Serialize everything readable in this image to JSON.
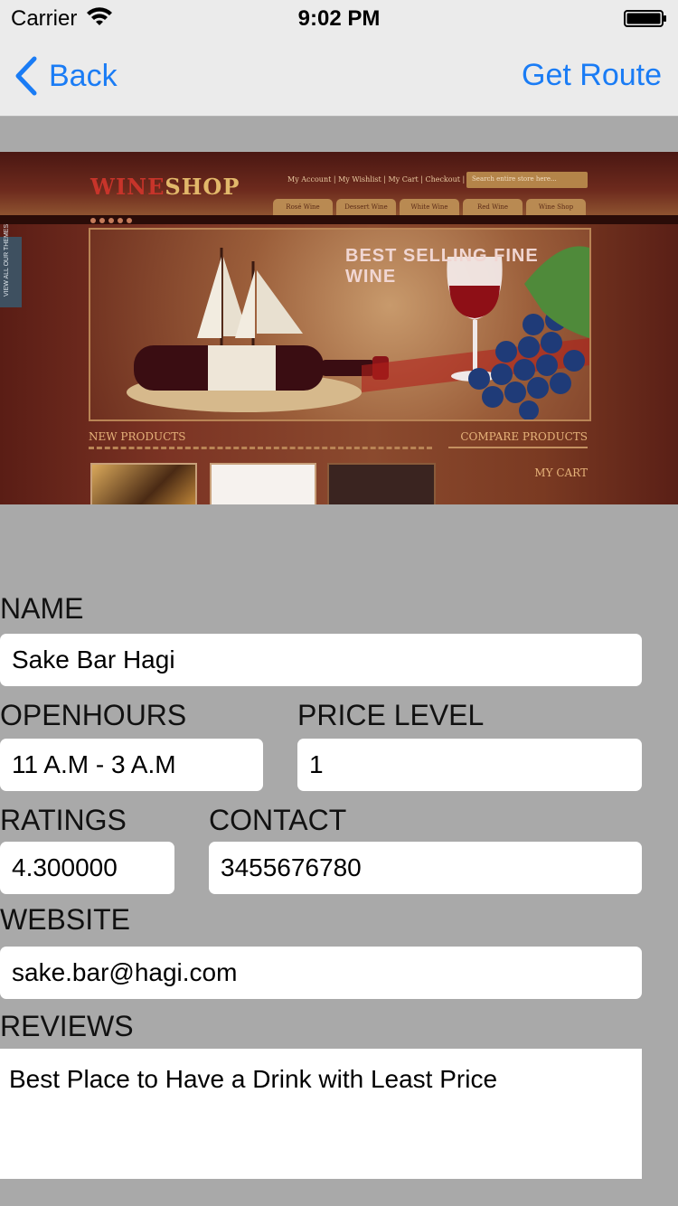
{
  "status_bar": {
    "carrier": "Carrier",
    "time": "9:02 PM"
  },
  "nav": {
    "back_label": "Back",
    "route_label": "Get Route"
  },
  "hero": {
    "logo_a": "WINE",
    "logo_b": "SHOP",
    "links": "My Account | My Wishlist | My Cart | Checkout | Log In",
    "search_placeholder": "Search entire store here...",
    "tabs": [
      "Rosé Wine",
      "Dessert Wine",
      "White Wine",
      "Red Wine",
      "Wine Shop"
    ],
    "side_text": "VIEW ALL OUR THEMES",
    "banner_title": "BEST SELLING FINE WINE",
    "new_products": "NEW PRODUCTS",
    "compare_products": "COMPARE PRODUCTS",
    "my_cart": "MY CART"
  },
  "form": {
    "name_label": "NAME",
    "name_value": "Sake Bar Hagi",
    "openhours_label": "OPENHOURS",
    "openhours_value": "11 A.M - 3 A.M",
    "price_label": "PRICE LEVEL",
    "price_value": "1",
    "ratings_label": "RATINGS",
    "ratings_value": "4.300000",
    "contact_label": "CONTACT",
    "contact_value": "3455676780",
    "website_label": "WEBSITE",
    "website_value": "sake.bar@hagi.com",
    "reviews_label": "REVIEWS",
    "reviews_value": "Best Place to Have a Drink with Least Price"
  },
  "colors": {
    "accent": "#1a7cf5",
    "background": "#a9a9a9",
    "bar": "#ebebeb"
  },
  "icons": {
    "back": "chevron-left-icon",
    "wifi": "wifi-icon",
    "battery": "battery-icon"
  }
}
